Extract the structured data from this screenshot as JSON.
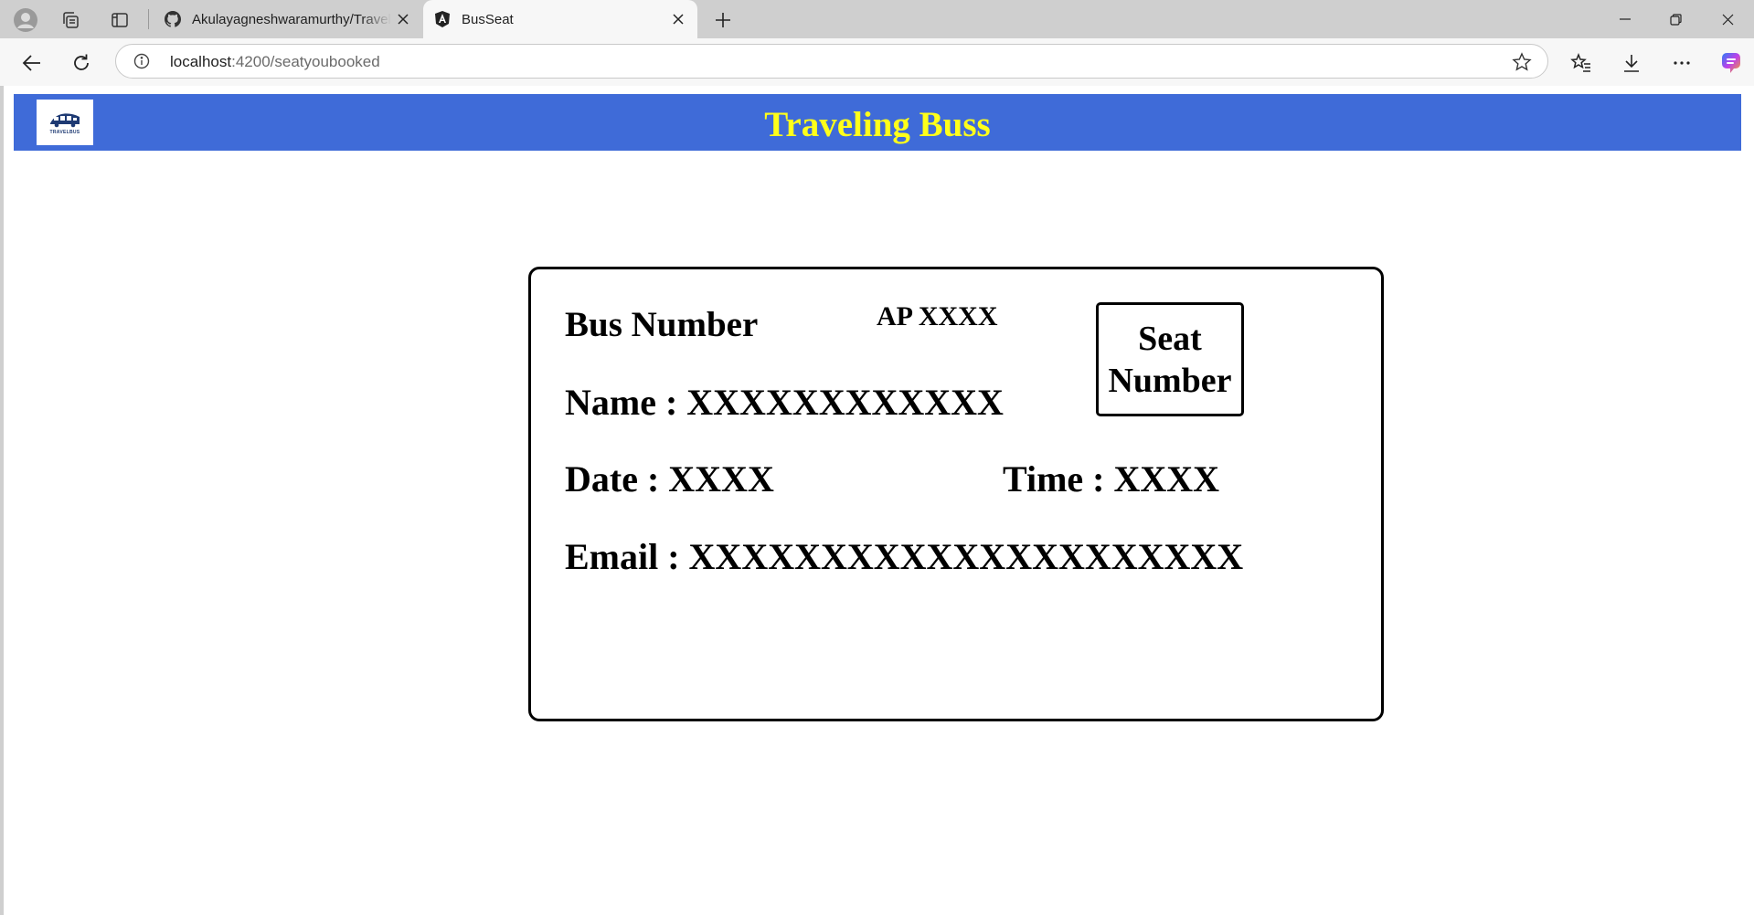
{
  "browser": {
    "tabs": [
      {
        "title": "Akulayagneshwaramurthy/Traveling",
        "favicon": "github-icon",
        "active": false
      },
      {
        "title": "BusSeat",
        "favicon": "angular-icon",
        "active": true
      }
    ],
    "address": {
      "host": "localhost",
      "path": ":4200/seatyoubooked"
    }
  },
  "app": {
    "logo_text": "TRAVELBUS",
    "title": "Traveling Buss",
    "colors": {
      "header_bg": "#3f6bd8",
      "title": "#ffff1a"
    }
  },
  "ticket": {
    "bus_number_label": "Bus Number",
    "bus_number_value": "AP XXXX",
    "seat_label": "Seat Number",
    "name": "Name : XXXXXXXXXXXX",
    "date": "Date : XXXX",
    "time": "Time : XXXX",
    "email": "Email : XXXXXXXXXXXXXXXXXXXXX"
  }
}
